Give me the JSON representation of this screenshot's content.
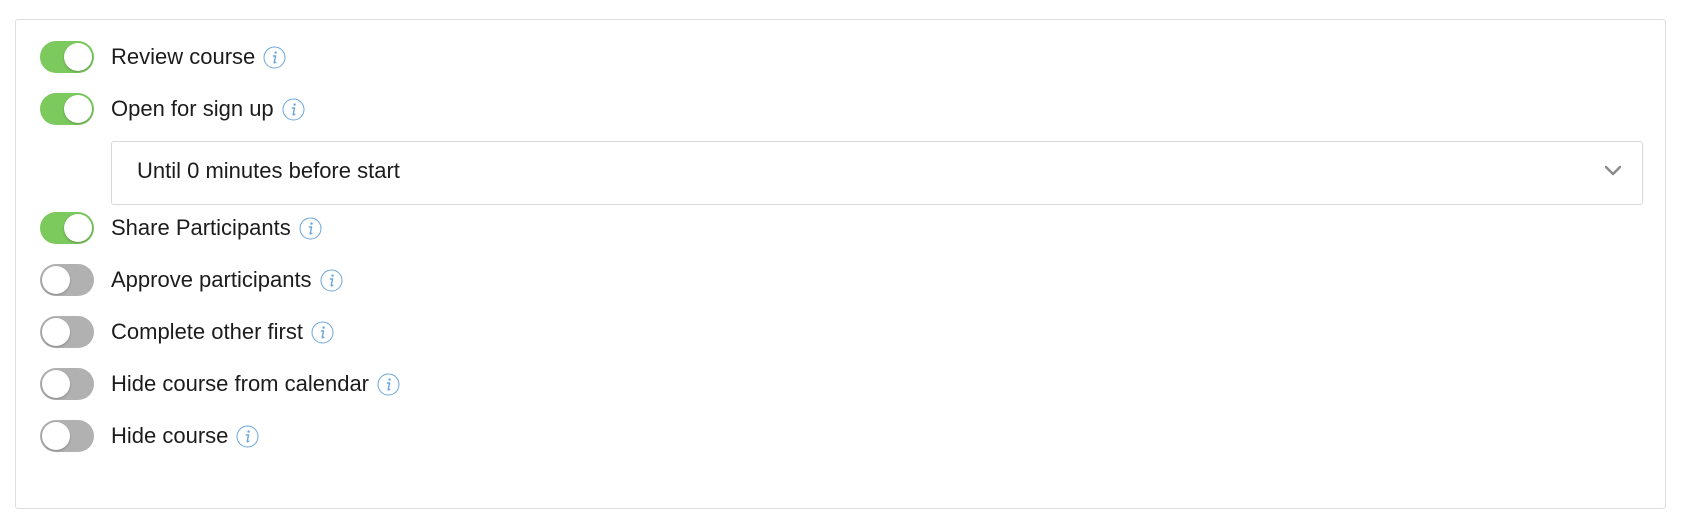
{
  "settings": {
    "items": [
      {
        "label": "Review course",
        "enabled": true,
        "toggle_icon": "toggle-on-icon",
        "info_icon": "info-icon"
      },
      {
        "label": "Open for sign up",
        "enabled": true,
        "toggle_icon": "toggle-on-icon",
        "info_icon": "info-icon"
      },
      {
        "label": "Share Participants",
        "enabled": true,
        "toggle_icon": "toggle-on-icon",
        "info_icon": "info-icon"
      },
      {
        "label": "Approve participants",
        "enabled": false,
        "toggle_icon": "toggle-off-icon",
        "info_icon": "info-icon"
      },
      {
        "label": "Complete other first",
        "enabled": false,
        "toggle_icon": "toggle-off-icon",
        "info_icon": "info-icon"
      },
      {
        "label": "Hide course from calendar",
        "enabled": false,
        "toggle_icon": "toggle-off-icon",
        "info_icon": "info-icon"
      },
      {
        "label": "Hide course",
        "enabled": false,
        "toggle_icon": "toggle-off-icon",
        "info_icon": "info-icon"
      }
    ],
    "signup_deadline": {
      "selected": "Until 0 minutes before start",
      "icon": "chevron-down-icon"
    }
  },
  "colors": {
    "toggle_on": "#7cc95e",
    "toggle_off": "#b1b1b1",
    "info_icon": "#6aa6dd",
    "border": "#dedede"
  }
}
